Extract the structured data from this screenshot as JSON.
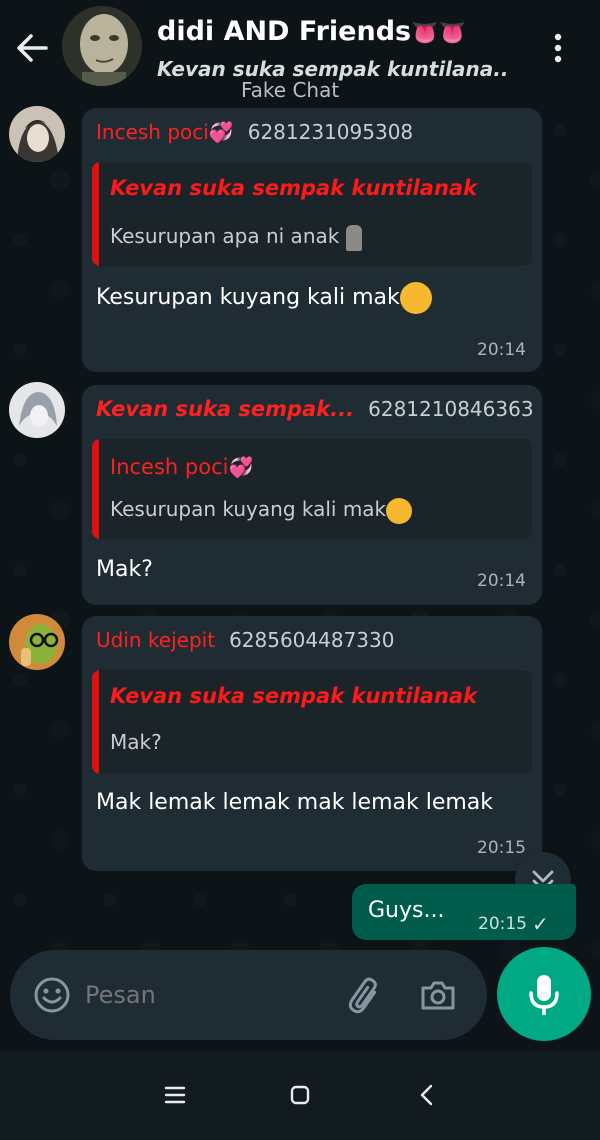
{
  "header": {
    "title": "didi AND Friends",
    "title_emoji": "👅👅",
    "subtitle": "Kevan suka sempak kuntilana..",
    "overlay_text": "Fake Chat"
  },
  "messages": [
    {
      "sender_name": "Incesh poci",
      "sender_emoji": "💞",
      "sender_phone": "6281231095308",
      "quote_author": "Kevan suka sempak kuntilanak",
      "quote_text": "Kesurupan apa ni anak",
      "quote_emoji": "🗿",
      "text": "Kesurupan kuyang kali mak",
      "text_emoji": "🤔",
      "time": "20:14"
    },
    {
      "sender_name": "Kevan suka sempak...",
      "sender_phone": "6281210846363",
      "quote_author": "Incesh poci",
      "quote_author_emoji": "💞",
      "quote_text": "Kesurupan kuyang kali mak",
      "quote_emoji": "🤔",
      "text": "Mak?",
      "time": "20:14"
    },
    {
      "sender_name": "Udin kejepit",
      "sender_phone": "6285604487330",
      "quote_author": "Kevan suka sempak kuntilanak",
      "quote_text": "Mak?",
      "text": "Mak lemak lemak mak lemak lemak",
      "time": "20:15"
    }
  ],
  "own_message": {
    "text": "Guys...",
    "time": "20:15",
    "status": "✓"
  },
  "composer": {
    "placeholder": "Pesan"
  },
  "icons": {
    "back": "arrow-left-icon",
    "menu": "more-vertical-icon",
    "emoji": "smiley-icon",
    "attach": "paperclip-icon",
    "camera": "camera-icon",
    "mic": "microphone-icon",
    "scroll": "double-chevron-down-icon"
  },
  "colors": {
    "background": "#0d1418",
    "bubble": "#202c33",
    "own_bubble": "#005c4b",
    "accent": "#00a884",
    "sender_red": "#ff2020"
  }
}
